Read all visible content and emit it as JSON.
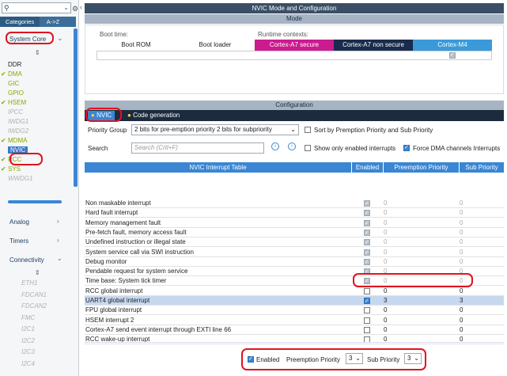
{
  "left": {
    "tabs": [
      "Categories",
      "A->Z"
    ],
    "system_core": "System Core",
    "items": [
      {
        "label": "DDR",
        "checked": false,
        "style": "plain"
      },
      {
        "label": "DMA",
        "checked": true,
        "style": "green"
      },
      {
        "label": "GIC",
        "checked": false,
        "style": "green"
      },
      {
        "label": "GPIO",
        "checked": false,
        "style": "green"
      },
      {
        "label": "HSEM",
        "checked": true,
        "style": "green"
      },
      {
        "label": "IPCC",
        "checked": false,
        "style": "grey"
      },
      {
        "label": "IWDG1",
        "checked": false,
        "style": "grey"
      },
      {
        "label": "IWDG2",
        "checked": false,
        "style": "grey"
      },
      {
        "label": "MDMA",
        "checked": true,
        "style": "green"
      },
      {
        "label": "NVIC",
        "checked": false,
        "style": "selected"
      },
      {
        "label": "RCC",
        "checked": true,
        "style": "green"
      },
      {
        "label": "SYS",
        "checked": true,
        "style": "green"
      },
      {
        "label": "WWDG1",
        "checked": false,
        "style": "grey"
      }
    ],
    "analog": "Analog",
    "timers": "Timers",
    "connectivity": "Connectivity",
    "conn_items": [
      "ETH1",
      "FDCAN1",
      "FDCAN2",
      "FMC",
      "I2C1",
      "I2C2",
      "I2C3",
      "I2C4"
    ]
  },
  "window_title": "NVIC Mode and Configuration",
  "mode": {
    "title": "Mode",
    "boot_time": "Boot time:",
    "runtime": "Runtime contexts:",
    "boot_rom": "Boot ROM",
    "boot_loader": "Boot loader",
    "a7s": "Cortex-A7 secure",
    "a7ns": "Cortex-A7 non secure",
    "m4": "Cortex-M4"
  },
  "config": {
    "title": "Configuration",
    "tab_nvic": "NVIC",
    "tab_codegen": "Code generation",
    "priority_group_label": "Priority Group",
    "priority_group_value": "2 bits for pre-emption priority 2 bits for subpriority",
    "sort_label": "Sort by Premption Priority and Sub Priority",
    "search_label": "Search",
    "search_placeholder": "Search (Crtl+F)",
    "show_enabled": "Show only enabled interrupts",
    "force_dma": "Force DMA channels Interrupts"
  },
  "table": {
    "headers": [
      "NVIC Interrupt Table",
      "Enabled",
      "Preemption Priority",
      "Sub Priority"
    ],
    "rows": [
      {
        "name": "Non maskable interrupt",
        "enabled": "locked",
        "pre": "0",
        "sub": "0"
      },
      {
        "name": "Hard fault interrupt",
        "enabled": "locked",
        "pre": "0",
        "sub": "0"
      },
      {
        "name": "Memory management fault",
        "enabled": "locked",
        "pre": "0",
        "sub": "0"
      },
      {
        "name": "Pre-fetch fault, memory access fault",
        "enabled": "locked",
        "pre": "0",
        "sub": "0"
      },
      {
        "name": "Undefined instruction or illegal state",
        "enabled": "locked",
        "pre": "0",
        "sub": "0"
      },
      {
        "name": "System service call via SWI instruction",
        "enabled": "locked",
        "pre": "0",
        "sub": "0"
      },
      {
        "name": "Debug monitor",
        "enabled": "locked",
        "pre": "0",
        "sub": "0"
      },
      {
        "name": "Pendable request for system service",
        "enabled": "locked",
        "pre": "0",
        "sub": "0"
      },
      {
        "name": "Time base: System tick timer",
        "enabled": "locked",
        "pre": "0",
        "sub": "0"
      },
      {
        "name": "RCC global interrupt",
        "enabled": "off",
        "pre": "0",
        "sub": "0"
      },
      {
        "name": "UART4 global interrupt",
        "enabled": "on",
        "pre": "3",
        "sub": "3"
      },
      {
        "name": "FPU global interrupt",
        "enabled": "off",
        "pre": "0",
        "sub": "0"
      },
      {
        "name": "HSEM interrupt 2",
        "enabled": "off",
        "pre": "0",
        "sub": "0"
      },
      {
        "name": "Cortex-A7 send event interrupt through EXTI line 66",
        "enabled": "off",
        "pre": "0",
        "sub": "0"
      },
      {
        "name": "RCC wake-up interrupt",
        "enabled": "off",
        "pre": "0",
        "sub": "0"
      }
    ]
  },
  "bottom": {
    "enabled": "Enabled",
    "pre_label": "Preemption Priority",
    "pre_value": "3",
    "sub_label": "Sub Priority",
    "sub_value": "3"
  }
}
